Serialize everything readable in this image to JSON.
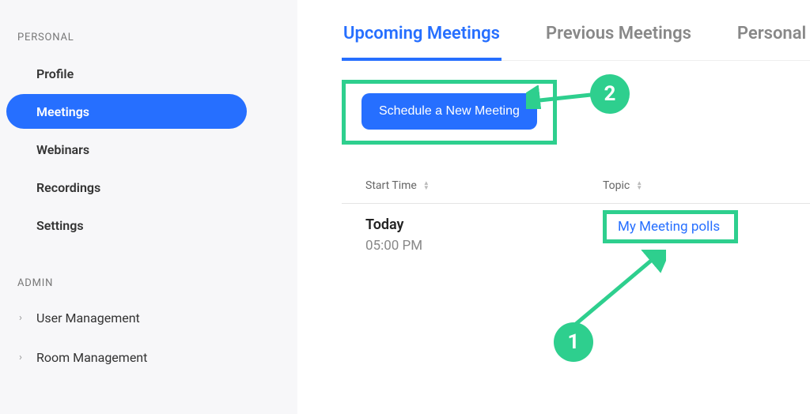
{
  "sidebar": {
    "personal_label": "PERSONAL",
    "admin_label": "ADMIN",
    "items": [
      {
        "label": "Profile"
      },
      {
        "label": "Meetings"
      },
      {
        "label": "Webinars"
      },
      {
        "label": "Recordings"
      },
      {
        "label": "Settings"
      }
    ],
    "admin_items": [
      {
        "label": "User Management"
      },
      {
        "label": "Room Management"
      }
    ]
  },
  "tabs": {
    "upcoming": "Upcoming Meetings",
    "previous": "Previous Meetings",
    "personal": "Personal M"
  },
  "schedule_button": "Schedule a New Meeting",
  "table": {
    "header_start": "Start Time",
    "header_topic": "Topic",
    "row": {
      "day": "Today",
      "time": "05:00 PM",
      "topic": "My Meeting polls"
    }
  },
  "callouts": {
    "one": "1",
    "two": "2"
  },
  "colors": {
    "accent": "#266fff",
    "highlight": "#2ecf8e"
  }
}
